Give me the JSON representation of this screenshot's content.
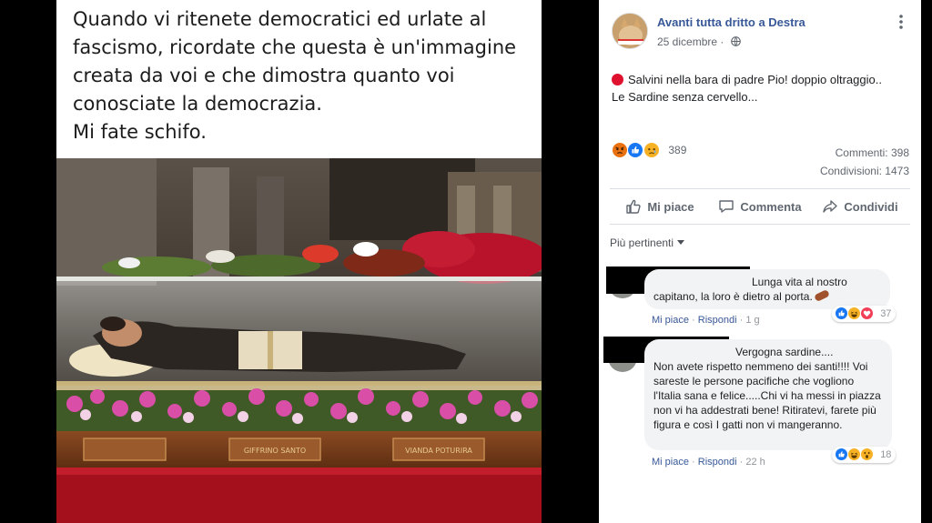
{
  "meme": {
    "caption": "Quando vi ritenete democratici ed urlate al\nfascismo, ricordate che questa è un'immagine\ncreata da voi e che dimostra quanto voi\nconosciate la democrazia.\nMi fate schifo.",
    "plaque_left": "GIFFRINO SANTO",
    "plaque_right": "VIANDA POTURIRA"
  },
  "post": {
    "page_name": "Avanti tutta dritto a Destra",
    "date": "25 dicembre",
    "text_line1": "Salvini nella bara di padre Pio! doppio oltraggio..",
    "text_line2": "Le Sardine senza cervello...",
    "reaction_icons": [
      "angry-icon",
      "like-icon",
      "sad-icon"
    ],
    "reaction_count": "389",
    "comments_label": "Commenti: 398",
    "shares_label": "Condivisioni: 1473"
  },
  "actions": {
    "like": "Mi piace",
    "comment": "Commenta",
    "share": "Condividi"
  },
  "filter": {
    "label": "Più pertinenti"
  },
  "comments": [
    {
      "text_line1": "Lunga vita al nostro",
      "text_line2": "capitano, la loro è dietro al porta.",
      "like": "Mi piace",
      "reply": "Rispondi",
      "time": "1 g",
      "reaction_icons": [
        "like-icon",
        "haha-icon",
        "love-icon"
      ],
      "reaction_count": "37"
    },
    {
      "text_line1": "Vergogna sardine....",
      "text_body": "Non avete rispetto nemmeno dei santi!!!! Voi sareste le persone pacifiche che vogliono l'Italia sana e felice.....Chi vi ha messi in piazza non vi ha addestrati bene! Ritiratevi, farete più figura e così I gatti non vi mangeranno.",
      "like": "Mi piace",
      "reply": "Rispondi",
      "time": "22 h",
      "reaction_icons": [
        "like-icon",
        "haha-icon",
        "wow-icon"
      ],
      "reaction_count": "18"
    }
  ],
  "colors": {
    "link_blue": "#385898",
    "meta_grey": "#90949c",
    "bubble_bg": "#f2f3f5",
    "like_blue": "#1877f2",
    "angry_orange": "#e9710f",
    "love_red": "#f33e58",
    "emoji_yellow": "#f7b125"
  }
}
